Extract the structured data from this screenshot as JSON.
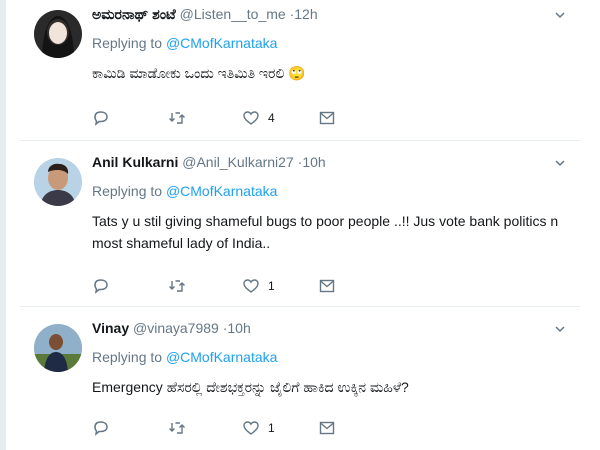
{
  "tweets": [
    {
      "name": "ಅಮರನಾಥ್ ಶಂಟೆ",
      "handle": "@Listen__to_me",
      "dot": "·",
      "time": "12h",
      "replying_prefix": "Replying to",
      "replying_to": "@CMofKarnataka",
      "text": "ಕಾಮಿಡಿ ಮಾಡೋಕು ಒಂದು ಇತಿಮಿತಿ ಇರಲಿ 🙄",
      "like_count": "4",
      "reply_count": "",
      "retweet_count": ""
    },
    {
      "name": "Anil Kulkarni",
      "handle": "@Anil_Kulkarni27",
      "dot": "·",
      "time": "10h",
      "replying_prefix": "Replying to",
      "replying_to": "@CMofKarnataka",
      "text": "Tats y u stil giving shameful bugs to poor people ..!! Jus vote bank politics n most shameful lady of India..",
      "like_count": "1",
      "reply_count": "",
      "retweet_count": ""
    },
    {
      "name": "Vinay",
      "handle": "@vinaya7989",
      "dot": "·",
      "time": "10h",
      "replying_prefix": "Replying to",
      "replying_to": "@CMofKarnataka",
      "text": "Emergency ಹೆಸರಲ್ಲಿ ದೇಶಭಕ್ತರನ್ನು ಜೈಲಿಗೆ ಹಾಕಿದ ಉಕ್ಕಿನ ಮಹಿಳೆ?",
      "like_count": "1",
      "reply_count": "",
      "retweet_count": ""
    }
  ],
  "icons": {
    "reply": "reply-icon",
    "retweet": "retweet-icon",
    "like": "heart-icon",
    "message": "envelope-icon",
    "menu": "chevron-down-icon"
  },
  "colors": {
    "link": "#1da1f2",
    "muted": "#657786",
    "text": "#14171a",
    "divider": "#e6ecf0"
  }
}
